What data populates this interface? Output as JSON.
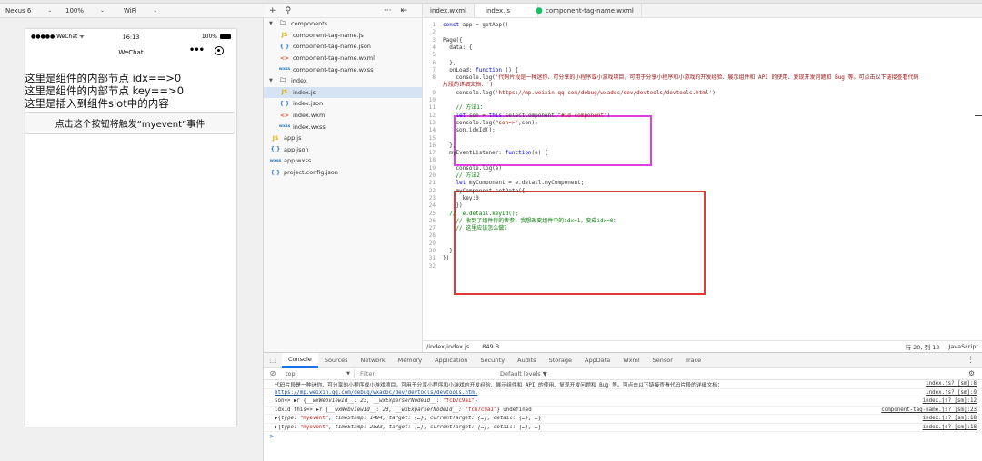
{
  "simulator_toolbar": {
    "device": "Nexus 6",
    "zoom": "100%",
    "network": "WiFi"
  },
  "phone": {
    "carrier": "●●●●● WeChat ᯤ",
    "time": "16:13",
    "battery": "100%",
    "nav_title": "WeChat",
    "lines": [
      "这里是组件的内部节点 idx==>0",
      "这里是组件的内部节点 key==>0",
      "这里是插入到组件slot中的内容"
    ],
    "button_label": "点击这个按钮将触发“myevent”事件"
  },
  "file_tree": {
    "toolbar": {
      "add": "+",
      "search": "⚲",
      "more": "···",
      "split": "⇤"
    },
    "items": [
      {
        "label": "components",
        "type": "folder",
        "depth": 0,
        "open": true
      },
      {
        "label": "component-tag-name.js",
        "type": "js",
        "depth": 1
      },
      {
        "label": "component-tag-name.json",
        "type": "json",
        "depth": 1
      },
      {
        "label": "component-tag-name.wxml",
        "type": "wxml",
        "depth": 1
      },
      {
        "label": "component-tag-name.wxss",
        "type": "wxss",
        "depth": 1
      },
      {
        "label": "index",
        "type": "folder",
        "depth": 0,
        "open": true
      },
      {
        "label": "index.js",
        "type": "js",
        "depth": 1,
        "selected": true
      },
      {
        "label": "index.json",
        "type": "json",
        "depth": 1
      },
      {
        "label": "index.wxml",
        "type": "wxml",
        "depth": 1
      },
      {
        "label": "index.wxss",
        "type": "wxss",
        "depth": 1
      },
      {
        "label": "app.js",
        "type": "js",
        "depth": 0
      },
      {
        "label": "app.json",
        "type": "json",
        "depth": 0
      },
      {
        "label": "app.wxss",
        "type": "wxss",
        "depth": 0
      },
      {
        "label": "project.config.json",
        "type": "json",
        "depth": 0
      }
    ],
    "icons": {
      "js": "JS",
      "json": "{ }",
      "wxml": "<>",
      "wxss": "wxss"
    }
  },
  "editor": {
    "tabs": [
      "index.wxml",
      "index.js",
      "component-tag-name.wxml"
    ],
    "modified_marker": "●",
    "code_lines": [
      {
        "n": "1",
        "t": [
          [
            "kw",
            "const"
          ],
          [
            "ct",
            " app = getApp()"
          ]
        ]
      },
      {
        "n": "2",
        "t": []
      },
      {
        "n": "3",
        "t": [
          [
            "ct",
            "Page({"
          ]
        ]
      },
      {
        "n": "4",
        "t": [
          [
            "ct",
            "  data: {"
          ]
        ]
      },
      {
        "n": "5",
        "t": []
      },
      {
        "n": "6",
        "t": [
          [
            "ct",
            "  },"
          ]
        ]
      },
      {
        "n": "7",
        "t": [
          [
            "ct",
            "  onLoad: "
          ],
          [
            "kw",
            "function"
          ],
          [
            "ct",
            " () {"
          ]
        ]
      },
      {
        "n": "8",
        "t": [
          [
            "ct",
            "    console.log("
          ],
          [
            "str",
            "'代码片段是一种迷你、可分享的小程序或小游戏项目，可用于分享小程序和小游戏的开发经验、展示组件和 API 的使用、复现开发问题和 Bug 等。可点击以下链接查看代码"
          ]
        ]
      },
      {
        "n": "",
        "t": [
          [
            "str",
            "片段的详细文档：'"
          ],
          [
            "ct",
            ")"
          ]
        ]
      },
      {
        "n": "9",
        "t": [
          [
            "ct",
            "    console.log("
          ],
          [
            "str",
            "'https://mp.weixin.qq.com/debug/wxadoc/dev/devtools/devtools.html'"
          ],
          [
            "ct",
            ")"
          ]
        ]
      },
      {
        "n": "10",
        "t": []
      },
      {
        "n": "11",
        "t": [
          [
            "cmt",
            "    // 方法1："
          ]
        ]
      },
      {
        "n": "12",
        "t": [
          [
            "ct",
            "    "
          ],
          [
            "kw",
            "let"
          ],
          [
            "ct",
            " son = "
          ],
          [
            "kw",
            "this"
          ],
          [
            "ct",
            ".selectComponent("
          ],
          [
            "str",
            "\"#id-component\""
          ],
          [
            "ct",
            ")"
          ]
        ]
      },
      {
        "n": "13",
        "t": [
          [
            "ct",
            "    console.log("
          ],
          [
            "str",
            "\"son=>\""
          ],
          [
            "ct",
            ",son);"
          ]
        ]
      },
      {
        "n": "14",
        "t": [
          [
            "ct",
            "    son.idxId();"
          ]
        ]
      },
      {
        "n": "15",
        "t": []
      },
      {
        "n": "16",
        "t": [
          [
            "ct",
            "  },"
          ]
        ]
      },
      {
        "n": "17",
        "t": [
          [
            "ct",
            "  myEventListener: "
          ],
          [
            "kw",
            "function"
          ],
          [
            "ct",
            "(e) {"
          ]
        ]
      },
      {
        "n": "18",
        "t": []
      },
      {
        "n": "19",
        "t": [
          [
            "ct",
            "    console.log(e)"
          ]
        ]
      },
      {
        "n": "20",
        "t": [
          [
            "cmt",
            "    // 方法2"
          ]
        ]
      },
      {
        "n": "21",
        "t": [
          [
            "ct",
            "    "
          ],
          [
            "kw",
            "let"
          ],
          [
            "ct",
            " myComponent = e.detail.myComponent;"
          ]
        ]
      },
      {
        "n": "22",
        "t": [
          [
            "ct",
            "    myComponent.setData({"
          ]
        ]
      },
      {
        "n": "23",
        "t": [
          [
            "ct",
            "      key:0"
          ]
        ]
      },
      {
        "n": "24",
        "t": [
          [
            "ct",
            "    })"
          ]
        ]
      },
      {
        "n": "25",
        "t": [
          [
            "cmt",
            "  //  e.detail.keyId();"
          ]
        ]
      },
      {
        "n": "26",
        "t": [
          [
            "cmt",
            "    // 收到了组件传的传参，我想改变组件中的idx=1，变成idx=0："
          ]
        ]
      },
      {
        "n": "27",
        "t": [
          [
            "cmt",
            "    // 这里应该怎么做？"
          ]
        ]
      },
      {
        "n": "28",
        "t": []
      },
      {
        "n": "29",
        "t": []
      },
      {
        "n": "30",
        "t": [
          [
            "ct",
            "  }"
          ]
        ]
      },
      {
        "n": "31",
        "t": [
          [
            "ct",
            "})"
          ]
        ]
      },
      {
        "n": "32",
        "t": []
      }
    ],
    "status": {
      "path": "/index/index.js",
      "size": "849 B",
      "position": "行 20, 列 12",
      "language": "JavaScript"
    }
  },
  "devtools": {
    "tabs": [
      "Console",
      "Sources",
      "Network",
      "Memory",
      "Application",
      "Security",
      "Audits",
      "Storage",
      "AppData",
      "Wxml",
      "Sensor",
      "Trace"
    ],
    "context": "top",
    "filter_placeholder": "Filter",
    "levels": "Default levels ▼",
    "logs": [
      {
        "msg": [
          [
            "plain",
            "代码片段是一种迷你、可分享的小程序或小游戏项目，可用于分享小程序和小游戏的开发经验、展示组件和 API 的使用、复现开发问题和 Bug 等。可点击以下链接查看代码片段的详细文档："
          ]
        ],
        "src": "index.js? [sm]:8"
      },
      {
        "msg": [
          [
            "link",
            "https://mp.weixin.qq.com/debug/wxadoc/dev/devtools/devtools.html"
          ]
        ],
        "src": "index.js? [sm]:9"
      },
      {
        "msg": [
          [
            "plain",
            "son=> ▶r {"
          ],
          [
            "it",
            "__wxWebviewId__: 23, __wxExparserNodeId__: "
          ],
          [
            "sv",
            "\"fcb7c9a1\""
          ],
          [
            "plain",
            "}"
          ]
        ],
        "src": "index.js? [sm]:12"
      },
      {
        "msg": [
          [
            "plain",
            "idxId this=> ▶r {"
          ],
          [
            "it",
            "__wxWebviewId__: 23, __wxExparserNodeId__: "
          ],
          [
            "sv",
            "\"fcb7c9a1\""
          ],
          [
            "plain",
            "} undefined"
          ]
        ],
        "src": "component-tag-name.js? [sm]:23"
      },
      {
        "msg": [
          [
            "plain",
            "▶{"
          ],
          [
            "it",
            "type: "
          ],
          [
            "sv",
            "\"myevent\""
          ],
          [
            "it",
            ", timeStamp: 1494, target: {…}, currentTarget: {…}, detail: {…}, …"
          ],
          [
            "plain",
            "}"
          ]
        ],
        "src": "index.js? [sm]:18"
      },
      {
        "msg": [
          [
            "plain",
            "▶{"
          ],
          [
            "it",
            "type: "
          ],
          [
            "sv",
            "\"myevent\""
          ],
          [
            "it",
            ", timeStamp: 2533, target: {…}, currentTarget: {…}, detail: {…}, …"
          ],
          [
            "plain",
            "}"
          ]
        ],
        "src": "index.js? [sm]:18"
      }
    ],
    "prompt": ">"
  }
}
